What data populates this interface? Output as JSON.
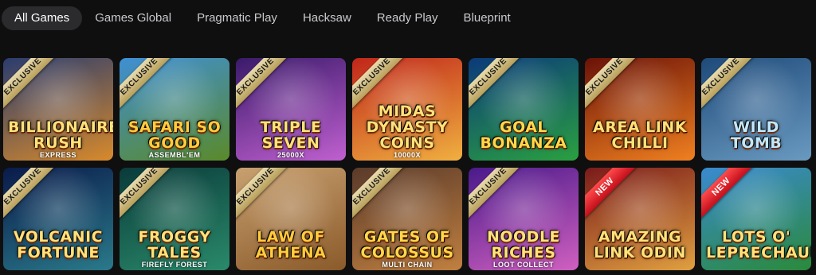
{
  "tabs": [
    {
      "label": "All Games",
      "active": true
    },
    {
      "label": "Games Global",
      "active": false
    },
    {
      "label": "Pragmatic Play",
      "active": false
    },
    {
      "label": "Hacksaw",
      "active": false
    },
    {
      "label": "Ready Play",
      "active": false
    },
    {
      "label": "Blueprint",
      "active": false
    }
  ],
  "games": [
    {
      "title": "Billionaire Rush",
      "sub": "EXPRESS",
      "badge": "EXCLUSIVE",
      "bg1": "#2a3c6e",
      "bg2": "#d88a2b",
      "title_color": "#ffe27a"
    },
    {
      "title": "Safari So Good",
      "sub": "ASSEMBL'EM",
      "badge": "EXCLUSIVE",
      "bg1": "#3f8fd4",
      "bg2": "#5a8a2a",
      "title_color": "#ffcc3d"
    },
    {
      "title": "Triple Seven",
      "sub": "25000X",
      "badge": "EXCLUSIVE",
      "bg1": "#3a1a6a",
      "bg2": "#c060d0",
      "title_color": "#ffe27a"
    },
    {
      "title": "Midas Dynasty Coins",
      "sub": "10000X",
      "badge": "EXCLUSIVE",
      "bg1": "#c0261a",
      "bg2": "#f0b040",
      "title_color": "#ffe27a"
    },
    {
      "title": "Goal Bonanza",
      "sub": "",
      "badge": "EXCLUSIVE",
      "bg1": "#0b3a7a",
      "bg2": "#2aa040",
      "title_color": "#ffd84a"
    },
    {
      "title": "Area Link Chilli",
      "sub": "",
      "badge": "EXCLUSIVE",
      "bg1": "#6a1208",
      "bg2": "#f08020",
      "title_color": "#ffe27a"
    },
    {
      "title": "Wild Tomb",
      "sub": "",
      "badge": "EXCLUSIVE",
      "bg1": "#1e4a7a",
      "bg2": "#6a9ac0",
      "title_color": "#bfe8ff"
    },
    {
      "title": "Volcanic Fortune",
      "sub": "",
      "badge": "EXCLUSIVE",
      "bg1": "#0a1a4a",
      "bg2": "#2a7a8a",
      "title_color": "#ffe27a"
    },
    {
      "title": "Froggy Tales",
      "sub": "FIREFLY FOREST",
      "badge": "EXCLUSIVE",
      "bg1": "#0a3a3a",
      "bg2": "#2a8a6a",
      "title_color": "#ffe27a"
    },
    {
      "title": "Law of Athena",
      "sub": "",
      "badge": "EXCLUSIVE",
      "bg1": "#c8a070",
      "bg2": "#8a5a2a",
      "title_color": "#ffcc3d"
    },
    {
      "title": "Gates of Colossus",
      "sub": "MULTI CHAIN",
      "badge": "EXCLUSIVE",
      "bg1": "#5a3a2a",
      "bg2": "#c08040",
      "title_color": "#ffd84a"
    },
    {
      "title": "Noodle Riches",
      "sub": "LOOT COLLECT",
      "badge": "EXCLUSIVE",
      "bg1": "#4a1a8a",
      "bg2": "#d060c0",
      "title_color": "#ffe27a"
    },
    {
      "title": "Amazing Link Odin",
      "sub": "",
      "badge": "NEW",
      "bg1": "#7a1a1a",
      "bg2": "#e0a040",
      "title_color": "#ffe27a"
    },
    {
      "title": "Lots o' Leprechauns",
      "sub": "",
      "badge": "NEW",
      "bg1": "#3a8ad0",
      "bg2": "#2a8a3a",
      "title_color": "#ffe27a"
    }
  ]
}
